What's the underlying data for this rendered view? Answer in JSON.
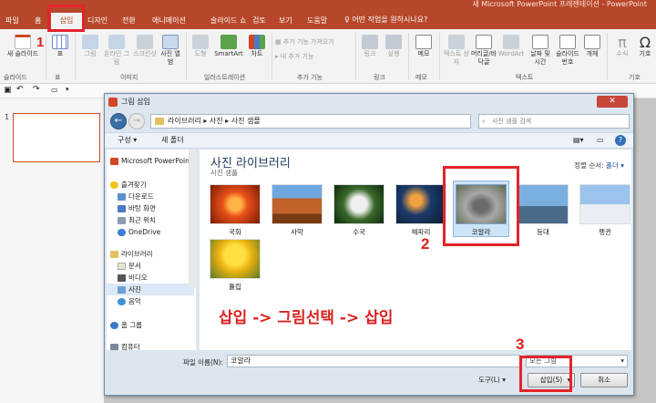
{
  "app": {
    "title": "새 Microsoft PowerPoint 프레젠테이션 - PowerPoint"
  },
  "ribbon_tabs": [
    "파일",
    "홈",
    "삽입",
    "디자인",
    "전환",
    "애니메이션",
    "슬라이드 쇼",
    "검토",
    "보기",
    "도움말"
  ],
  "tell_me": "어떤 작업을 원하시나요?",
  "ribbon": {
    "new_slide": "새 슬라이드",
    "table": "표",
    "picture": "그림",
    "online_picture": "온라인 그림",
    "screenshot": "스크린샷",
    "photo_album": "사진 앨범",
    "shapes": "도형",
    "smartart": "SmartArt",
    "chart": "차트",
    "get_addins": "추가 기능 가져오기",
    "my_addins": "내 추가 기능",
    "link": "링크",
    "action": "실행",
    "comment": "메모",
    "textbox": "텍스트 상자",
    "header_footer": "머리글/바닥글",
    "wordart": "WordArt",
    "date_time": "날짜 및 시간",
    "slide_number": "슬라이드 번호",
    "object": "개체",
    "equation": "수식",
    "symbol": "기호",
    "groups": {
      "slides": "슬라이드",
      "tables": "표",
      "images": "이미지",
      "illustrations": "일러스트레이션",
      "addins": "추가 기능",
      "links": "링크",
      "comments": "메모",
      "text": "텍스트",
      "symbols": "기호"
    }
  },
  "slide_panel": {
    "slide_number": "1"
  },
  "dialog": {
    "title": "그림 삽입",
    "path": "라이브러리 ▸ 사진 ▸ 사진 샘플",
    "search_placeholder": "사진 샘플 검색",
    "organize": "구성 ▾",
    "new_folder": "새 폴더",
    "nav": {
      "top": "Microsoft PowerPoint",
      "favorites": "즐겨찾기",
      "downloads": "다운로드",
      "desktop": "바탕 화면",
      "recent": "최근 위치",
      "onedrive": "OneDrive",
      "libraries": "라이브러리",
      "documents": "문서",
      "videos": "비디오",
      "pictures": "사진",
      "music": "음악",
      "homegroup": "홈 그룹",
      "computer": "컴퓨터"
    },
    "library_title": "사진 라이브러리",
    "library_subtitle": "사진 샘플",
    "sort_label": "정렬 순서:",
    "sort_value": "폴더 ▾",
    "photos": [
      "국화",
      "사막",
      "수국",
      "해파리",
      "코알라",
      "등대",
      "펭귄",
      "튤립"
    ],
    "file_name_label": "파일 이름(N):",
    "file_name_value": "코알라",
    "filter_value": "모든 그림",
    "tools": "도구(L)",
    "insert_button": "삽입(S)",
    "cancel_button": "취소"
  },
  "annotations": {
    "step1": "1",
    "step2": "2",
    "step3": "3",
    "instruction": "삽입 -> 그림선택 -> 삽입"
  },
  "colors": {
    "ppt_brand": "#b7472a",
    "annotation_red": "#e3242b"
  }
}
